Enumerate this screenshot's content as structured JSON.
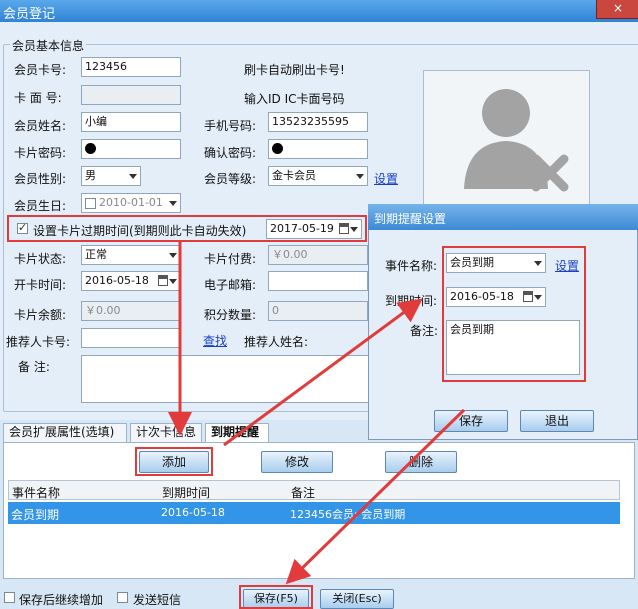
{
  "window": {
    "title": "会员登记",
    "close": "×"
  },
  "section": {
    "legend": "会员基本信息"
  },
  "form": {
    "card_no_label": "会员卡号:",
    "card_no_value": "123456",
    "card_no_hint": "刷卡自动刷出卡号!",
    "face_no_label": "卡 面 号:",
    "face_no_hint": "输入ID IC卡面号码",
    "name_label": "会员姓名:",
    "name_value": "小编",
    "phone_label": "手机号码:",
    "phone_value": "13523235595",
    "pwd_label": "卡片密码:",
    "confirm_label": "确认密码:",
    "gender_label": "会员性别:",
    "gender_value": "男",
    "level_label": "会员等级:",
    "level_value": "金卡会员",
    "level_link": "设置",
    "birthday_label": "会员生日:",
    "birthday_value": "2010-01-01",
    "expiry_checkbox_label": "设置卡片过期时间(到期则此卡自动失效)",
    "expiry_value": "2017-05-19",
    "status_label": "卡片状态:",
    "status_value": "正常",
    "fee_label": "卡片付费:",
    "fee_value": "￥0.00",
    "open_label": "开卡时间:",
    "open_value": "2016-05-18",
    "email_label": "电子邮箱:",
    "balance_label": "卡片余额:",
    "balance_value": "￥0.00",
    "points_label": "积分数量:",
    "points_value": "0",
    "referrer_label": "推荐人卡号:",
    "referrer_link": "查找",
    "referrer_name_label": "推荐人姓名:",
    "remark_label": "备  注:"
  },
  "tabs": [
    {
      "label": "会员扩展属性(选填)"
    },
    {
      "label": "计次卡信息"
    },
    {
      "label": "到期提醒"
    }
  ],
  "panel": {
    "add_button": "添加",
    "edit_button": "修改",
    "delete_button": "删除",
    "columns": [
      "事件名称",
      "到期时间",
      "备注"
    ],
    "rows": [
      {
        "event": "会员到期",
        "date": "2016-05-18",
        "note": "123456会员: 会员到期"
      }
    ]
  },
  "bottom": {
    "keep_adding": "保存后继续增加",
    "send_sms": "发送短信",
    "save_button": "保存(F5)",
    "close_button": "关闭(Esc)"
  },
  "dialog": {
    "title": "到期提醒设置",
    "event_label": "事件名称:",
    "event_value": "会员到期",
    "event_link": "设置",
    "date_label": "到期时间:",
    "date_value": "2016-05-18",
    "note_label": "备注:",
    "note_value": "会员到期",
    "save_button": "保存",
    "exit_button": "退出"
  },
  "colors": {
    "highlight": "#e23b3b",
    "selection": "#3395e8",
    "titlebar": "#2f83d6"
  }
}
